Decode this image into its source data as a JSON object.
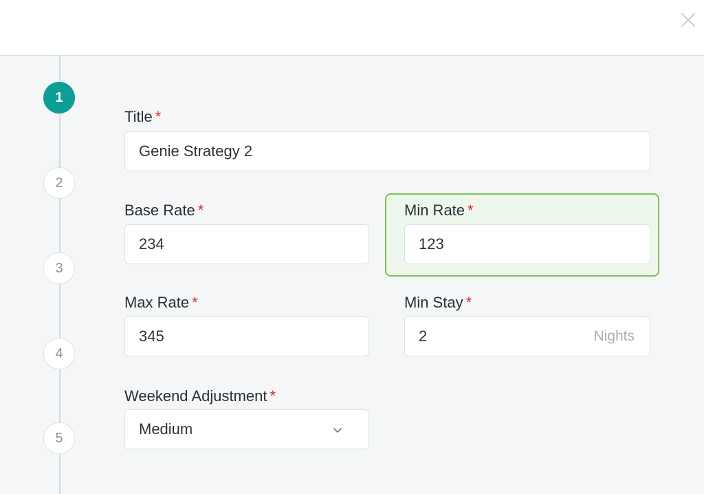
{
  "header": {
    "close_icon": "close-icon"
  },
  "stepper": {
    "steps": [
      {
        "number": "1",
        "active": true
      },
      {
        "number": "2",
        "active": false
      },
      {
        "number": "3",
        "active": false
      },
      {
        "number": "4",
        "active": false
      },
      {
        "number": "5",
        "active": false
      }
    ]
  },
  "form": {
    "title": {
      "label": "Title",
      "required": "*",
      "value": "Genie Strategy 2"
    },
    "base_rate": {
      "label": "Base Rate",
      "required": "*",
      "value": "234"
    },
    "min_rate": {
      "label": "Min Rate",
      "required": "*",
      "value": "123"
    },
    "max_rate": {
      "label": "Max Rate",
      "required": "*",
      "value": "345"
    },
    "min_stay": {
      "label": "Min Stay",
      "required": "*",
      "value": "2",
      "suffix": "Nights"
    },
    "weekend_adjustment": {
      "label": "Weekend Adjustment",
      "required": "*",
      "value": "Medium",
      "icon": "chevron-down-icon"
    }
  },
  "colors": {
    "accent": "#0e9e96",
    "required": "#d22f2f",
    "highlight_border": "#7cc25a"
  }
}
